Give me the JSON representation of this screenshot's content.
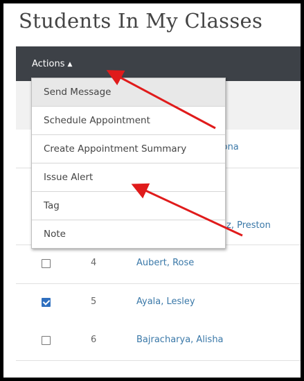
{
  "page": {
    "title": "Students In My Classes"
  },
  "toolbar": {
    "actions_label": "Actions",
    "actions_indicator": "▲"
  },
  "menu": {
    "items": [
      {
        "label": "Send Message"
      },
      {
        "label": "Schedule Appointment"
      },
      {
        "label": "Create Appointment Summary"
      },
      {
        "label": "Issue Alert"
      },
      {
        "label": "Tag"
      },
      {
        "label": "Note"
      }
    ]
  },
  "table": {
    "partial_texts": {
      "row1_name_fragment": "iona",
      "row3_name_fragment": "z, Preston"
    },
    "rows": [
      {
        "number": "4",
        "name": "Aubert, Rose",
        "checked": false
      },
      {
        "number": "5",
        "name": "Ayala, Lesley",
        "checked": true
      },
      {
        "number": "6",
        "name": "Bajracharya, Alisha",
        "checked": false
      }
    ]
  },
  "annotations": {
    "arrow_color": "#e01b1b"
  }
}
